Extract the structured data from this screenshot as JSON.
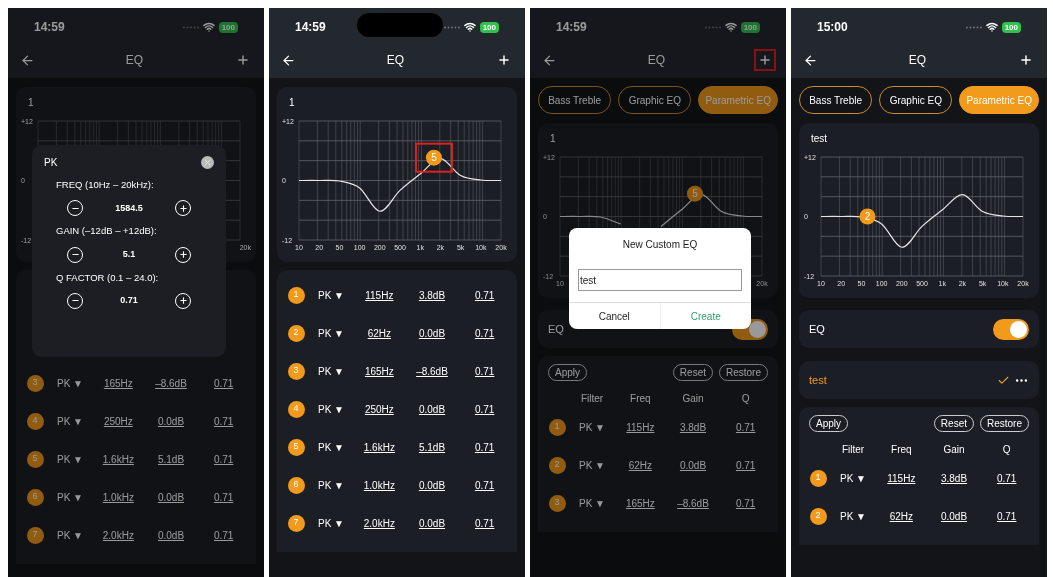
{
  "phones": [
    {
      "time": "14:59",
      "battery": "100",
      "notch": false,
      "title": "EQ",
      "plus_highlighted": false,
      "graph": {
        "title": "1",
        "y_labels": [
          "+12",
          "0",
          "-12"
        ],
        "x_labels": [
          "20k"
        ]
      },
      "table": {
        "rows": [
          {
            "index": "3",
            "filter": "PK ▼",
            "freq": "165Hz",
            "gain": "–8.6dB",
            "q": "0.71"
          },
          {
            "index": "4",
            "filter": "PK ▼",
            "freq": "250Hz",
            "gain": "0.0dB",
            "q": "0.71"
          },
          {
            "index": "5",
            "filter": "PK ▼",
            "freq": "1.6kHz",
            "gain": "5.1dB",
            "q": "0.71"
          },
          {
            "index": "6",
            "filter": "PK ▼",
            "freq": "1.0kHz",
            "gain": "0.0dB",
            "q": "0.71"
          },
          {
            "index": "7",
            "filter": "PK ▼",
            "freq": "2.0kHz",
            "gain": "0.0dB",
            "q": "0.71"
          }
        ]
      },
      "dialog": {
        "kind": "band_editor",
        "title": "PK",
        "params": [
          {
            "label": "FREQ (10Hz – 20kHz):",
            "value": "1584.5"
          },
          {
            "label": "GAIN (–12dB – +12dB):",
            "value": "5.1"
          },
          {
            "label": "Q FACTOR (0.1 – 24.0):",
            "value": "0.71"
          }
        ]
      }
    },
    {
      "time": "14:59",
      "battery": "100",
      "notch": true,
      "title": "EQ",
      "plus_highlighted": false,
      "graph": {
        "title": "1",
        "marker": {
          "label": "5",
          "highlighted": true
        },
        "chart_data": {
          "type": "line",
          "ylim": [
            -12,
            12
          ],
          "grid": true,
          "yticks": [
            {
              "value": 12,
              "label": "+12"
            },
            {
              "value": 0,
              "label": "0"
            },
            {
              "value": -12,
              "label": "-12"
            }
          ],
          "categories": [
            "10",
            "20",
            "50",
            "100",
            "200",
            "500",
            "1k",
            "2k",
            "5k",
            "10k",
            "20k"
          ],
          "series": [
            {
              "color": "#e5e5e5",
              "values": [
                0,
                0,
                -0.1,
                -1.5,
                -6.2,
                -2,
                1.3,
                4.4,
                1,
                0.1,
                0
              ]
            }
          ]
        }
      },
      "table": {
        "rows": [
          {
            "index": "1",
            "filter": "PK ▼",
            "freq": "115Hz",
            "gain": "3.8dB",
            "q": "0.71"
          },
          {
            "index": "2",
            "filter": "PK ▼",
            "freq": "62Hz",
            "gain": "0.0dB",
            "q": "0.71"
          },
          {
            "index": "3",
            "filter": "PK ▼",
            "freq": "165Hz",
            "gain": "–8.6dB",
            "q": "0.71"
          },
          {
            "index": "4",
            "filter": "PK ▼",
            "freq": "250Hz",
            "gain": "0.0dB",
            "q": "0.71"
          },
          {
            "index": "5",
            "filter": "PK ▼",
            "freq": "1.6kHz",
            "gain": "5.1dB",
            "q": "0.71"
          },
          {
            "index": "6",
            "filter": "PK ▼",
            "freq": "1.0kHz",
            "gain": "0.0dB",
            "q": "0.71"
          },
          {
            "index": "7",
            "filter": "PK ▼",
            "freq": "2.0kHz",
            "gain": "0.0dB",
            "q": "0.71"
          }
        ]
      }
    },
    {
      "time": "14:59",
      "battery": "100",
      "notch": false,
      "title": "EQ",
      "plus_highlighted": true,
      "tabs": [
        {
          "label": "Bass Treble",
          "selected": false
        },
        {
          "label": "Graphic EQ",
          "selected": false
        },
        {
          "label": "Parametric EQ",
          "selected": true
        }
      ],
      "graph": {
        "title": "1",
        "marker": {
          "label": "5",
          "highlighted": false
        },
        "chart_data": {
          "type": "line",
          "ylim": [
            -12,
            12
          ],
          "yticks": [
            {
              "value": 12,
              "label": "+12"
            },
            {
              "value": 0,
              "label": "0"
            },
            {
              "value": -12,
              "label": "-12"
            }
          ],
          "categories": [
            "10",
            null,
            null,
            null,
            null,
            null,
            null,
            null,
            null,
            null,
            "20k"
          ],
          "grid": true,
          "series": [
            {
              "color": "#e5e5e5",
              "values": [
                0,
                0,
                -0.1,
                -1.5,
                null,
                -2,
                1.3,
                4.4,
                1,
                0.1,
                0
              ]
            }
          ]
        }
      },
      "eq_switch": {
        "label": "EQ",
        "on": true
      },
      "table": {
        "actions": [
          "Apply",
          "Reset",
          "Restore"
        ],
        "columns": [
          "Filter",
          "Freq",
          "Gain",
          "Q"
        ],
        "rows": [
          {
            "index": "1",
            "filter": "PK ▼",
            "freq": "115Hz",
            "gain": "3.8dB",
            "q": "0.71"
          },
          {
            "index": "2",
            "filter": "PK ▼",
            "freq": "62Hz",
            "gain": "0.0dB",
            "q": "0.71"
          },
          {
            "index": "3",
            "filter": "PK ▼",
            "freq": "165Hz",
            "gain": "–8.6dB",
            "q": "0.71"
          }
        ]
      },
      "dialog": {
        "kind": "name_prompt",
        "title": "New Custom EQ",
        "value": "test",
        "buttons": [
          {
            "label": "Cancel",
            "primary": false
          },
          {
            "label": "Create",
            "primary": true
          }
        ]
      }
    },
    {
      "time": "15:00",
      "battery": "100",
      "notch": false,
      "title": "EQ",
      "plus_highlighted": false,
      "tabs": [
        {
          "label": "Bass Treble",
          "selected": false
        },
        {
          "label": "Graphic EQ",
          "selected": false
        },
        {
          "label": "Parametric EQ",
          "selected": true
        }
      ],
      "graph": {
        "title": "test",
        "marker": {
          "label": "2",
          "highlighted": false
        },
        "chart_data": {
          "type": "line",
          "ylim": [
            -12,
            12
          ],
          "grid": true,
          "yticks": [
            {
              "value": 12,
              "label": "+12"
            },
            {
              "value": 0,
              "label": "0"
            },
            {
              "value": -12,
              "label": "-12"
            }
          ],
          "categories": [
            "10",
            "20",
            "50",
            "100",
            "200",
            "500",
            "1k",
            "2k",
            "5k",
            "10k",
            "20k"
          ],
          "series": [
            {
              "color": "#e5e5e5",
              "values": [
                0,
                0,
                -0.1,
                -1.5,
                -6.2,
                -2,
                1.3,
                4.4,
                1,
                0.1,
                0
              ]
            }
          ]
        }
      },
      "eq_switch": {
        "label": "EQ",
        "on": true
      },
      "preset": {
        "name": "test",
        "selected": true
      },
      "table": {
        "actions": [
          "Apply",
          "Reset",
          "Restore"
        ],
        "columns": [
          "Filter",
          "Freq",
          "Gain",
          "Q"
        ],
        "rows": [
          {
            "index": "1",
            "filter": "PK ▼",
            "freq": "115Hz",
            "gain": "3.8dB",
            "q": "0.71"
          },
          {
            "index": "2",
            "filter": "PK ▼",
            "freq": "62Hz",
            "gain": "0.0dB",
            "q": "0.71"
          }
        ]
      }
    }
  ]
}
